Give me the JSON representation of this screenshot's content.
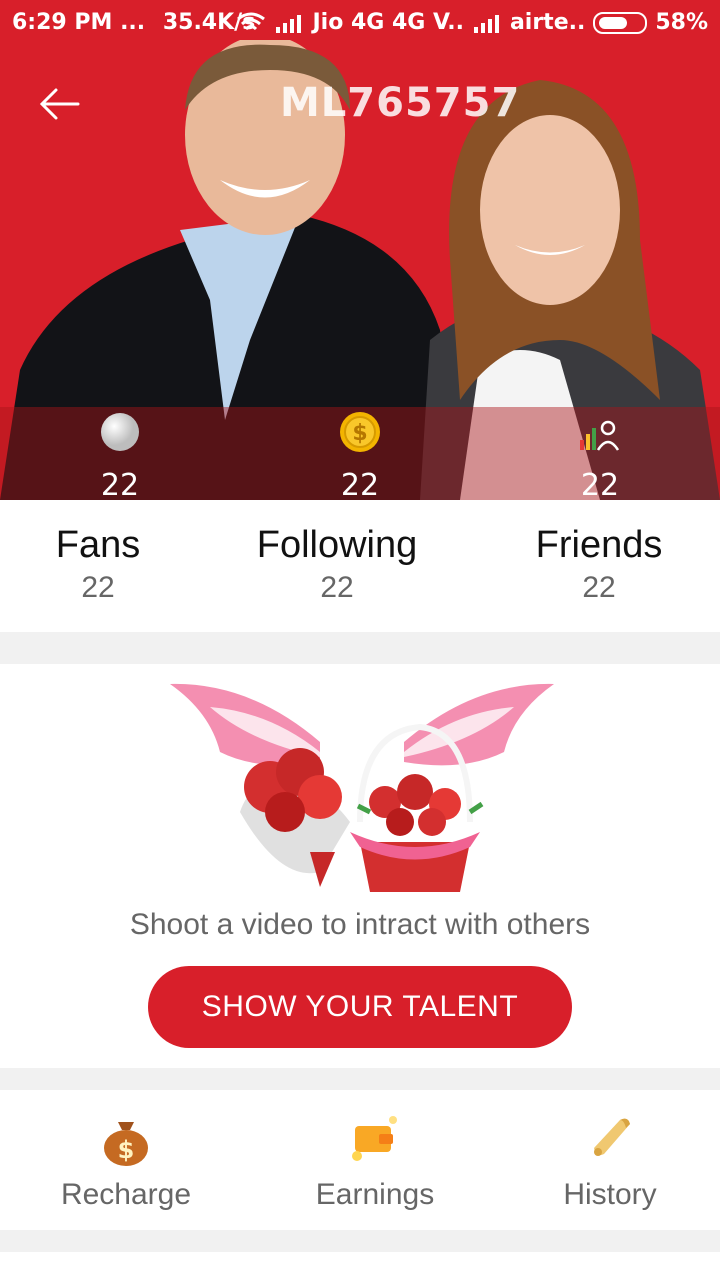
{
  "statusbar": {
    "time": "6:29 PM",
    "dots": "...",
    "speed": "35.4K/s",
    "carrier1": "Jio 4G 4G V..",
    "carrier2": "airte..",
    "battery": "58%"
  },
  "header": {
    "title": "ML765757",
    "back_icon": "back-arrow-icon"
  },
  "stats": [
    {
      "icon": "pearl-icon",
      "value": "22"
    },
    {
      "icon": "coin-icon",
      "value": "22"
    },
    {
      "icon": "level-icon",
      "value": "22"
    }
  ],
  "counts": [
    {
      "label": "Fans",
      "value": "22"
    },
    {
      "label": "Following",
      "value": "22"
    },
    {
      "label": "Friends",
      "value": "22"
    }
  ],
  "promo": {
    "message": "Shoot a video to intract with others",
    "button": "SHOW YOUR TALENT"
  },
  "wallet": [
    {
      "icon": "money-bag-icon",
      "label": "Recharge"
    },
    {
      "icon": "wallet-icon",
      "label": "Earnings"
    },
    {
      "icon": "scroll-icon",
      "label": "History"
    }
  ],
  "colors": {
    "accent": "#d81f2a"
  }
}
